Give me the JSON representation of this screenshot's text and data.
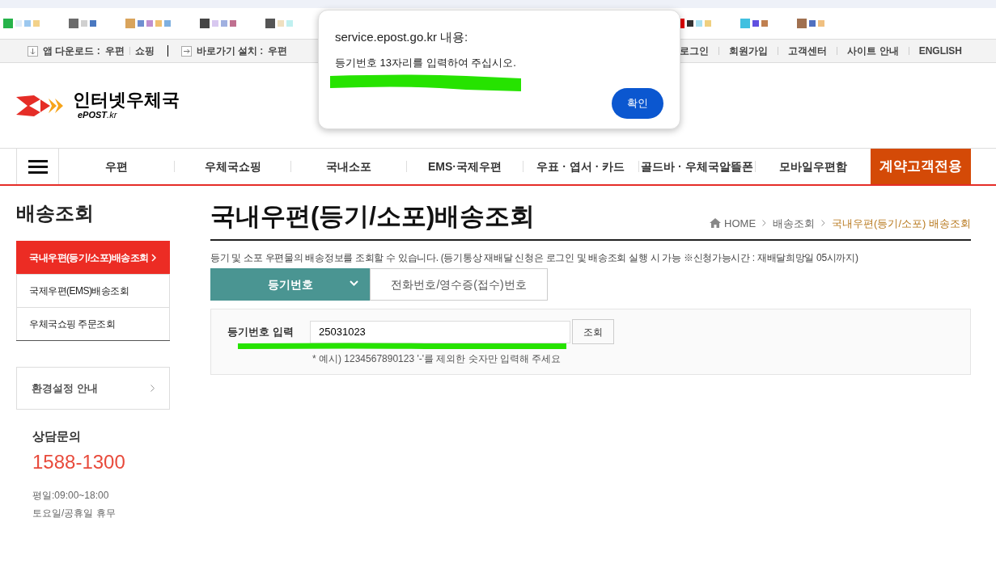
{
  "dialog": {
    "title": "service.epost.go.kr 내용:",
    "message": "등기번호 13자리를 입력하여 주십시오.",
    "button": "확인"
  },
  "top_bar": {
    "app_download_label": "앱 다운로드 :",
    "app_links": [
      "우편",
      "쇼핑"
    ],
    "shortcut_label": "바로가기 설치 :",
    "shortcut_links": [
      "우편"
    ],
    "user_links": [
      "로그인",
      "회원가입",
      "고객센터",
      "사이트 안내",
      "ENGLISH"
    ]
  },
  "logo": {
    "name": "인터넷우체국",
    "sub": "**ePOST**.kr"
  },
  "nav": [
    {
      "label": "우편",
      "kind": "link"
    },
    {
      "label": "우체국쇼핑",
      "kind": "link"
    },
    {
      "label": "국내소포",
      "kind": "link"
    },
    {
      "label": "EMS·국제우편",
      "kind": "link"
    },
    {
      "label": "우표 · 엽서 · 카드",
      "kind": "link"
    },
    {
      "label": "골드바 · 우체국알뜰폰",
      "kind": "link"
    },
    {
      "label": "모바일우편함",
      "kind": "link"
    },
    {
      "label": "계약고객전용",
      "kind": "highlight"
    }
  ],
  "sidebar": {
    "title": "배송조회",
    "items": [
      {
        "label": "국내우편(등기/소포)배송조회",
        "selected": true
      },
      {
        "label": "국제우편(EMS)배송조회",
        "selected": false
      },
      {
        "label": "우체국쇼핑 주문조회",
        "selected": false
      }
    ],
    "settings_link": "환경설정 안내",
    "contact": {
      "title": "상담문의",
      "phone": "1588-1300",
      "hours": [
        "평일:09:00~18:00",
        "토요일/공휴일 휴무"
      ]
    }
  },
  "main": {
    "title": "국내우편(등기/소포)배송조회",
    "breadcrumb": [
      "HOME",
      "배송조회",
      "국내우편(등기/소포) 배송조회"
    ],
    "description": "등기 및 소포 우편물의 배송정보를 조회할 수 있습니다. (등기통상 재배달 신청은 로그인 및 배송조회 실행 시 가능 ※신청가능시간 : 재배달희망일 05시까지)",
    "tabs": [
      {
        "label": "등기번호",
        "selected": true
      },
      {
        "label": "전화번호/영수증(접수)번호",
        "selected": false
      }
    ],
    "form": {
      "label": "등기번호 입력",
      "value": "25031023",
      "button": "조회",
      "hint": "* 예시) 1234567890123 '-'를 제외한 숫자만 입력해 주세요"
    }
  }
}
